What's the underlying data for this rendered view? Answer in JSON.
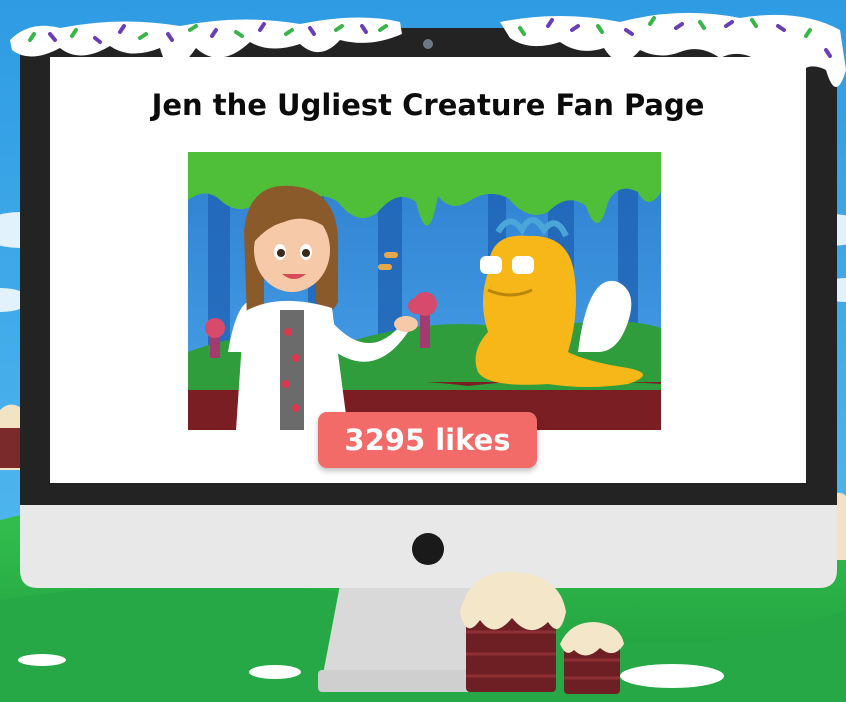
{
  "page": {
    "title": "Jen the Ugliest Creature Fan Page"
  },
  "likes": {
    "label": "3295 likes"
  },
  "colors": {
    "sky": "#3aa6e6",
    "grass": "#2fb54a",
    "monitor_bezel": "#222222",
    "monitor_chin": "#e6e6e6",
    "screen_bg": "#ffffff",
    "likes_button": "#f26b68",
    "frosting": "#ffffff",
    "sprinkle_green": "#3ab54a",
    "sprinkle_purple": "#6a3fb5",
    "creature": "#f7b718",
    "lab_coat": "#ffffff"
  },
  "icons": {
    "camera": "camera-dot-icon",
    "power": "power-button-icon"
  }
}
